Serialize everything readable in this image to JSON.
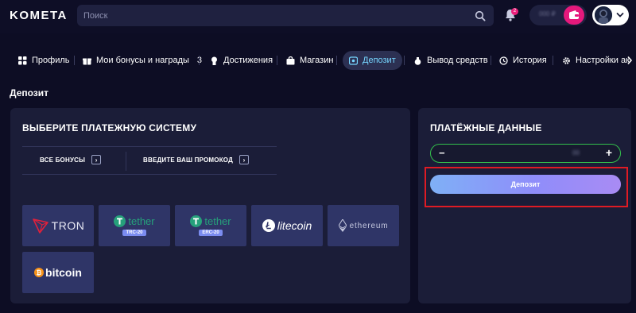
{
  "header": {
    "logo": "KOMETA",
    "search_placeholder": "Поиск",
    "notification_count": "2",
    "balance_blurred": "000 ₽"
  },
  "nav": {
    "items": [
      {
        "label": "Профиль",
        "icon": "grid-icon"
      },
      {
        "label": "Мои бонусы и награды",
        "count": "3",
        "icon": "gift-icon"
      },
      {
        "label": "Достижения",
        "icon": "medal-icon"
      },
      {
        "label": "Магазин",
        "icon": "shop-icon"
      },
      {
        "label": "Депозит",
        "icon": "deposit-icon",
        "active": true
      },
      {
        "label": "Вывод средств",
        "icon": "money-bag-icon"
      },
      {
        "label": "История",
        "icon": "clock-icon"
      },
      {
        "label": "Настройки ак",
        "icon": "gear-icon"
      }
    ]
  },
  "page": {
    "title": "Депозит"
  },
  "payment_systems": {
    "title": "ВЫБЕРИТЕ ПЛАТЕЖНУЮ СИСТЕМУ",
    "all_bonuses_label": "ВСЕ БОНУСЫ",
    "promo_label": "ВВЕДИТЕ ВАШ ПРОМОКОД",
    "methods": [
      {
        "name": "TRON"
      },
      {
        "name": "tether",
        "network": "TRC-20"
      },
      {
        "name": "tether",
        "network": "ERC-20"
      },
      {
        "name": "litecoin"
      },
      {
        "name": "ethereum"
      },
      {
        "name": "bitcoin"
      }
    ]
  },
  "payment_data": {
    "title": "ПЛАТЁЖНЫЕ ДАННЫЕ",
    "minus": "−",
    "plus": "+",
    "amount_blurred": "00",
    "deposit_button": "Депозит"
  },
  "colors": {
    "background": "#0d0d24",
    "panel": "#1b1d38",
    "tile": "#2f3567",
    "accent_active": "#76d6ff",
    "input_border": "#33c04c",
    "highlight": "#e01b24",
    "tron_red": "#e0213b",
    "tether_green": "#26a17b",
    "bitcoin_orange": "#f7931a"
  }
}
